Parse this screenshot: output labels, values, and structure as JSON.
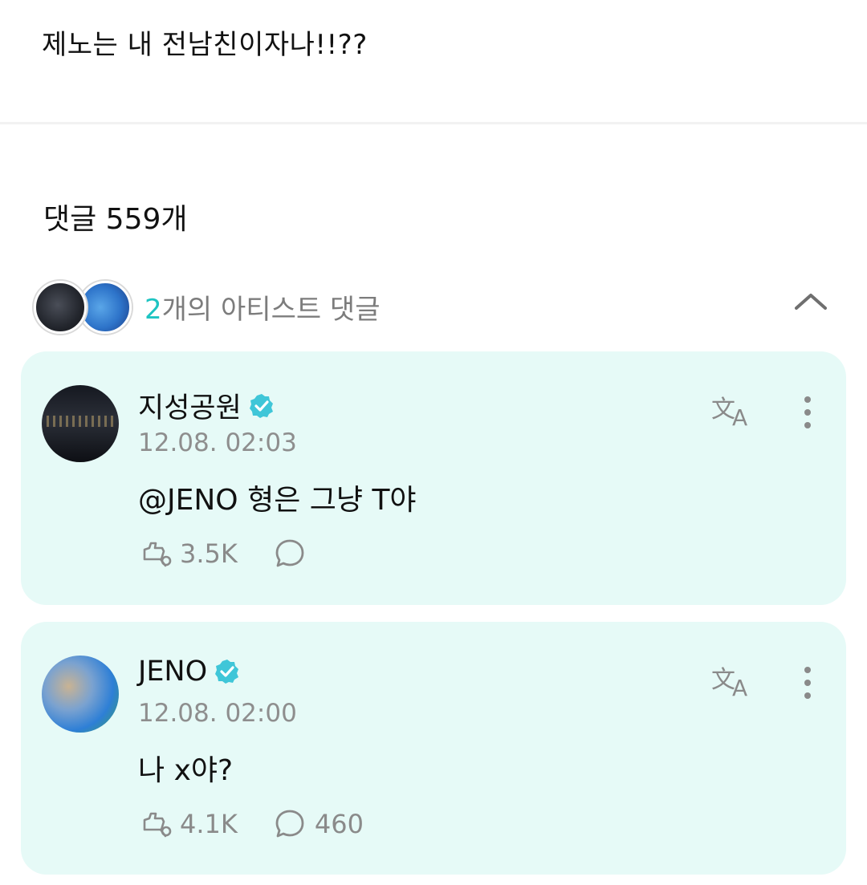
{
  "post": {
    "text": "제노는 내 전남친이자나!!??"
  },
  "comments_header": {
    "label": "댓글 559개"
  },
  "artist_comments": {
    "count": "2",
    "label_suffix": "개의 아티스트 댓글"
  },
  "colors": {
    "accent": "#1ec4c2",
    "card_bg": "#e6faf7",
    "muted": "#8e8e8e"
  },
  "comments": [
    {
      "author": "지성공원",
      "verified": true,
      "time": "12.08. 02:03",
      "text": "@JENO 형은 그냥 T야",
      "likes": "3.5K",
      "replies": ""
    },
    {
      "author": "JENO",
      "verified": true,
      "time": "12.08. 02:00",
      "text": "나 x야?",
      "likes": "4.1K",
      "replies": "460"
    }
  ]
}
